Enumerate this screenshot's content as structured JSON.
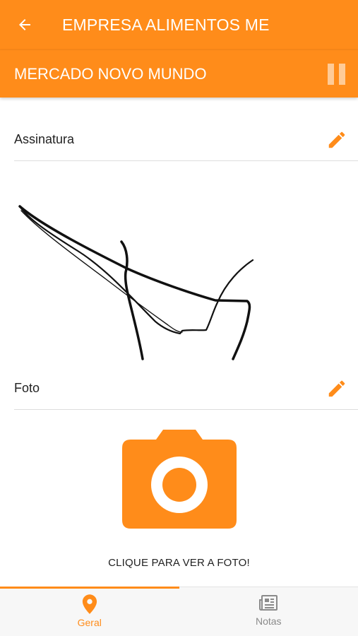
{
  "app_bar": {
    "title": "EMPRESA ALIMENTOS ME",
    "back_icon": "arrow-back-icon"
  },
  "sub_bar": {
    "title": "MERCADO NOVO MUNDO",
    "action_icon": "pause-icon"
  },
  "sections": {
    "signature": {
      "label": "Assinatura",
      "edit_icon": "pencil-icon"
    },
    "photo": {
      "label": "Foto",
      "edit_icon": "pencil-icon"
    }
  },
  "photo_caption": "CLIQUE PARA VER A FOTO!",
  "bottom_nav": {
    "items": [
      {
        "label": "Geral",
        "icon": "location-pin-icon",
        "active": true
      },
      {
        "label": "Notas",
        "icon": "newspaper-icon",
        "active": false
      }
    ]
  },
  "colors": {
    "accent": "#ff8c1a",
    "text": "#222222",
    "inactive": "#8a8a8a"
  }
}
